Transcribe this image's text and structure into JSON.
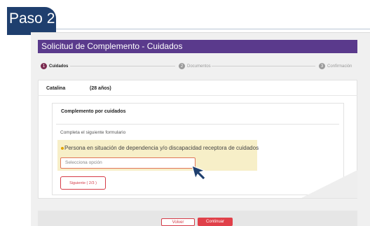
{
  "step_tab": {
    "label": "Paso 2"
  },
  "header": {
    "title": "Solicitud de Complemento - Cuidados"
  },
  "stepper": {
    "steps": [
      {
        "number": "1",
        "label": "Cuidados",
        "state": "active"
      },
      {
        "number": "2",
        "label": "Documentos",
        "state": "pending"
      },
      {
        "number": "3",
        "label": "Confirmación",
        "state": "pending"
      }
    ]
  },
  "person": {
    "name": "Catalina",
    "age": "(28 años)"
  },
  "section": {
    "title": "Complemento por cuidados",
    "intro": "Completa el siguiente formulario",
    "question": "Persona en situación de dependencia y/o discapacidad receptora de cuidados",
    "select_placeholder": "Selecciona opción",
    "next_label": "Siguiente ( 2/3 )"
  },
  "footer": {
    "back_label": "Volver",
    "continue_label": "Continuar"
  },
  "colors": {
    "brand_dark": "#1f3f6e",
    "header": "#5a3a8c",
    "accent": "#e04049",
    "highlight": "#f7efc8",
    "active_step": "#7a2a4f",
    "pending_step": "#9a9a9a"
  }
}
